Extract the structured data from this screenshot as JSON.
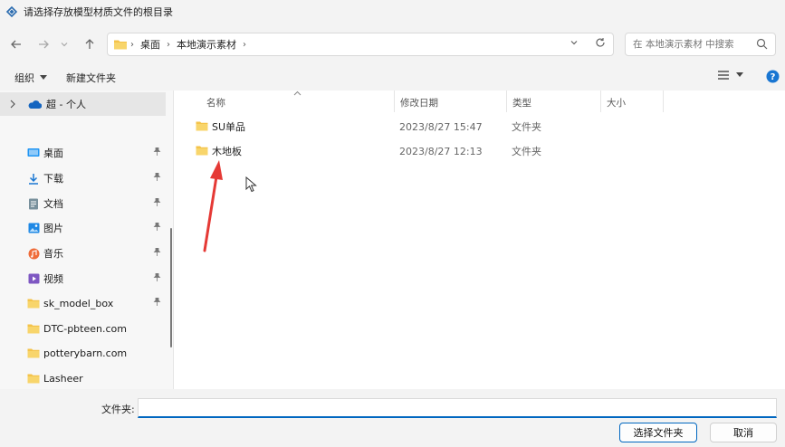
{
  "window": {
    "title": "请选择存放模型材质文件的根目录"
  },
  "address": {
    "crumbs": [
      "桌面",
      "本地演示素材"
    ]
  },
  "search": {
    "placeholder": "在 本地演示素材 中搜索"
  },
  "toolbar": {
    "organize": "组织",
    "new_folder": "新建文件夹"
  },
  "sidebar": {
    "top": "超 - 个人",
    "items": [
      {
        "label": "桌面",
        "icon": "desktop-icon",
        "pinned": true
      },
      {
        "label": "下载",
        "icon": "download-icon",
        "pinned": true
      },
      {
        "label": "文档",
        "icon": "document-icon",
        "pinned": true
      },
      {
        "label": "图片",
        "icon": "pictures-icon",
        "pinned": true
      },
      {
        "label": "音乐",
        "icon": "music-icon",
        "pinned": true
      },
      {
        "label": "视频",
        "icon": "video-icon",
        "pinned": true
      },
      {
        "label": "sk_model_box",
        "icon": "folder-icon",
        "pinned": true
      },
      {
        "label": "DTC-pbteen.com",
        "icon": "folder-icon",
        "pinned": false
      },
      {
        "label": "potterybarn.com",
        "icon": "folder-icon",
        "pinned": false
      },
      {
        "label": "Lasheer",
        "icon": "folder-icon",
        "pinned": false
      }
    ]
  },
  "columns": {
    "name": "名称",
    "date": "修改日期",
    "type": "类型",
    "size": "大小"
  },
  "files": [
    {
      "name": "SU单品",
      "date": "2023/8/27 15:47",
      "type": "文件夹"
    },
    {
      "name": "木地板",
      "date": "2023/8/27 12:13",
      "type": "文件夹"
    }
  ],
  "footer": {
    "label": "文件夹:",
    "value": "",
    "select": "选择文件夹",
    "cancel": "取消"
  },
  "colors": {
    "accent": "#0067c0",
    "folder": "#f4c34a",
    "annotation": "#e53935"
  }
}
